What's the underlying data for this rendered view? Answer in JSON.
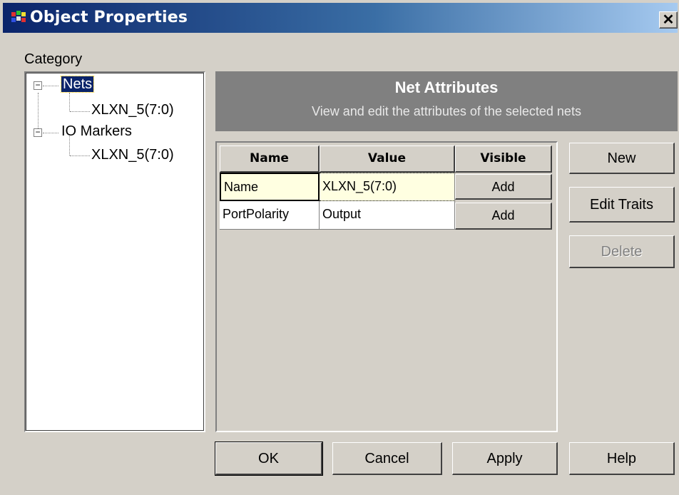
{
  "window": {
    "title": "Object Properties"
  },
  "category_label": "Category",
  "tree": {
    "nets_label": "Nets",
    "nets_child": "XLXN_5(7:0)",
    "io_label": "IO Markers",
    "io_child": "XLXN_5(7:0)"
  },
  "header": {
    "title": "Net Attributes",
    "subtitle": "View and edit the attributes of the selected nets"
  },
  "table": {
    "columns": [
      "Name",
      "Value",
      "Visible"
    ],
    "rows": [
      {
        "name": "Name",
        "value": "XLXN_5(7:0)",
        "visible": "Add"
      },
      {
        "name": "PortPolarity",
        "value": "Output",
        "visible": "Add"
      }
    ]
  },
  "side_buttons": {
    "new": "New",
    "edit_traits": "Edit Traits",
    "delete": "Delete"
  },
  "bottom_buttons": {
    "ok": "OK",
    "cancel": "Cancel",
    "apply": "Apply",
    "help": "Help"
  },
  "colors": {
    "title_start": "#0a246a",
    "header_bg": "#808080",
    "selected_row": "#ffffe1"
  }
}
